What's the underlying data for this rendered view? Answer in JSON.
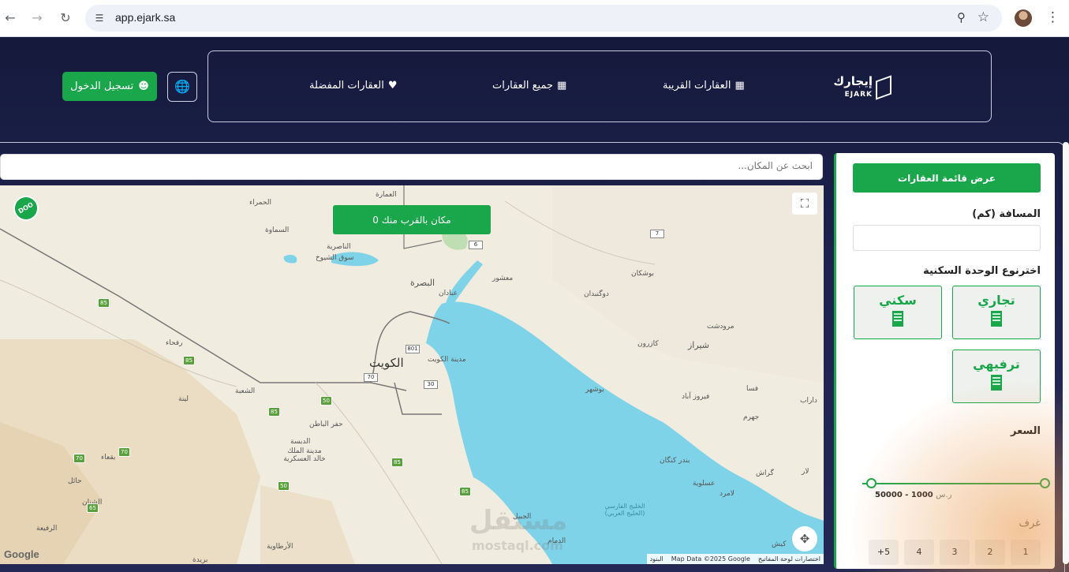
{
  "browser": {
    "url": "app.ejark.sa",
    "back_icon": "arrow-left-icon",
    "forward_icon": "arrow-right-icon",
    "reload_icon": "reload-icon"
  },
  "header": {
    "logo_ar": "إيجارك",
    "logo_en": "EJARK",
    "nav": {
      "nearby": "العقارات القريبة",
      "all": "جميع العقارات",
      "favorites": "العقارات المفضلة"
    },
    "login": "تسجيل الدخول"
  },
  "search": {
    "placeholder": "ابحث عن المكان..."
  },
  "map": {
    "near_button": "0 مكان بالقرب منك",
    "cities": {
      "kuwait": "الكويت",
      "basra": "البصرة",
      "shiraz": "شيراز",
      "kuwait_city": "مدينة الكويت",
      "bushehr": "بوشهر",
      "dammam": "الدمام",
      "jubail": "الجبيل",
      "nasiriyah": "الناصرية",
      "samawah": "السماوة",
      "hafr": "حفر الباطن",
      "rafha": "رفحاء",
      "hail": "حائل",
      "shuhba": "الشعبة",
      "linah": "لينة",
      "abadan": "عبادان",
      "ahwaz_mashur": "معشور",
      "artawiyah": "الأرطاوية",
      "gulf": "الخليج الفارسي (الخليج العربي)",
      "lamerd": "لامرد",
      "kazerun": "كازرون",
      "fasa": "فسا",
      "jahrom": "جهرم",
      "assaluyeh": "عسلوية",
      "bandar_kangan": "بندر كنگان",
      "kish": "كيش",
      "qatif_kkmc": "مدينة الملك خالد العسكرية",
      "dibdibah": "الدبسة",
      "buqaa": "بقعاء",
      "burayda": "بريدة",
      "shinan": "الشنان",
      "rafi": "الرفيعة",
      "hamra": "الحمراء",
      "ammara": "العمارة",
      "suq": "سوق الشيوخ",
      "dogonbadan": "دوگنبدان",
      "marvdasht": "مرودشت",
      "bushkan": "بوشکان",
      "firuzabad": "فیروز آباد",
      "darab": "داراب",
      "lar": "لار",
      "gerash": "گراش"
    },
    "watermark": "مستقل",
    "watermark_en": "mostaql.com",
    "google": "Google",
    "attribution": [
      "اختصارات لوحة المفاتيح",
      "Map Data ©2025 Google",
      "البنود"
    ]
  },
  "sidebar": {
    "list_button": "عرض قائمة العقارات",
    "distance_label": "المسافة (كم)",
    "unit_type_label": "اخترنوع الوحدة السكنية",
    "units": [
      "تجاري",
      "سكني",
      "ترفيهي"
    ],
    "price_label": "السعر",
    "price_range": "1000 - 50000",
    "currency": "ر.س",
    "price_min": 1000,
    "price_max": 50000,
    "rooms_label": "غرف",
    "rooms": [
      "1",
      "2",
      "3",
      "4",
      "5+"
    ]
  }
}
